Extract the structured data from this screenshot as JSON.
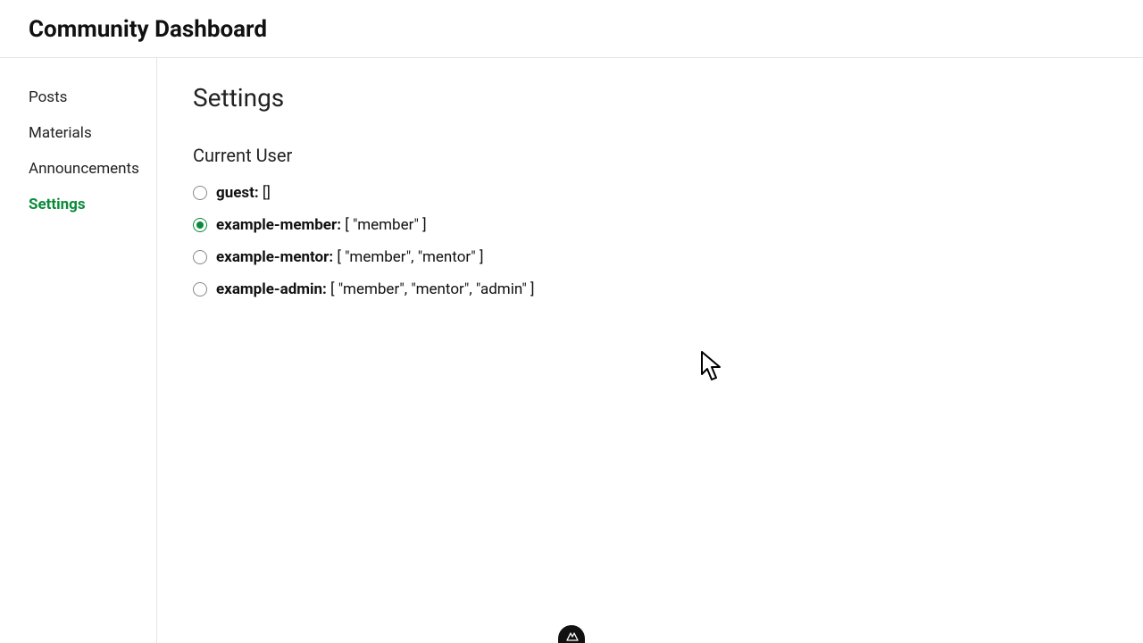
{
  "header": {
    "title": "Community Dashboard"
  },
  "sidebar": {
    "items": [
      {
        "label": "Posts",
        "active": false
      },
      {
        "label": "Materials",
        "active": false
      },
      {
        "label": "Announcements",
        "active": false
      },
      {
        "label": "Settings",
        "active": true
      }
    ]
  },
  "main": {
    "page_title": "Settings",
    "section_title": "Current User",
    "users": [
      {
        "name": "guest",
        "roles_display": "[]",
        "selected": false
      },
      {
        "name": "example-member",
        "roles_display": "[ \"member\" ]",
        "selected": true
      },
      {
        "name": "example-mentor",
        "roles_display": "[ \"member\", \"mentor\" ]",
        "selected": false
      },
      {
        "name": "example-admin",
        "roles_display": "[ \"member\", \"mentor\", \"admin\" ]",
        "selected": false
      }
    ]
  }
}
